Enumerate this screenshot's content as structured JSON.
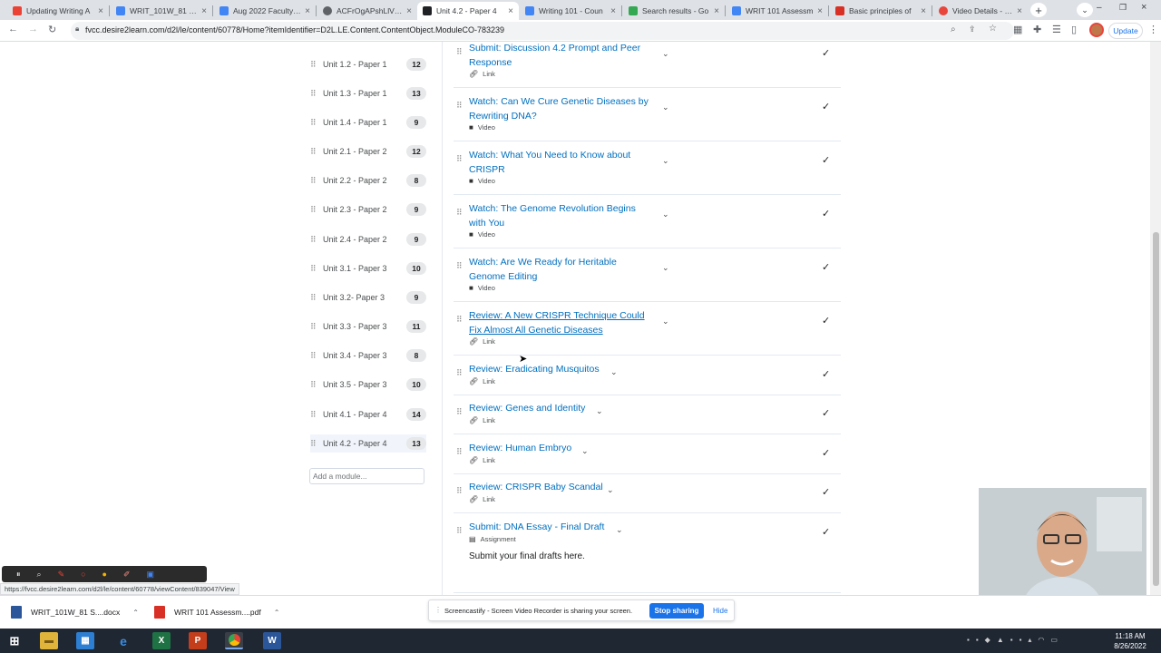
{
  "browser": {
    "tabs": [
      {
        "title": "Updating Writing A",
        "color": "#ea4335"
      },
      {
        "title": "WRIT_101W_81 SP..",
        "color": "#4285f4"
      },
      {
        "title": "Aug 2022 Faculty In",
        "color": "#4285f4"
      },
      {
        "title": "ACFrOgAPshLlVhg",
        "color": "#5f6368"
      },
      {
        "title": "Unit 4.2 - Paper 4",
        "color": "#202124"
      },
      {
        "title": "Writing 101 - Coun",
        "color": "#4285f4"
      },
      {
        "title": "Search results - Go",
        "color": "#34a853"
      },
      {
        "title": "WRIT 101 Assessm",
        "color": "#4285f4"
      },
      {
        "title": "Basic principles of",
        "color": "#d93025"
      },
      {
        "title": "Video Details - Scre",
        "color": "#e8453c"
      }
    ],
    "url": "fvcc.desire2learn.com/d2l/le/content/60778/Home?itemIdentifier=D2L.LE.Content.ContentObject.ModuleCO-783239",
    "update_label": "Update",
    "status_url": "https://fvcc.desire2learn.com/d2l/le/content/60778/viewContent/839047/View"
  },
  "modules": [
    {
      "label": "Unit 1.2 - Paper 1",
      "count": "12"
    },
    {
      "label": "Unit 1.3 - Paper 1",
      "count": "13"
    },
    {
      "label": "Unit 1.4 - Paper 1",
      "count": "9"
    },
    {
      "label": "Unit 2.1 - Paper 2",
      "count": "12"
    },
    {
      "label": "Unit 2.2 - Paper 2",
      "count": "8"
    },
    {
      "label": "Unit 2.3 - Paper 2",
      "count": "9"
    },
    {
      "label": "Unit 2.4 - Paper 2",
      "count": "9"
    },
    {
      "label": "Unit 3.1 - Paper 3",
      "count": "10"
    },
    {
      "label": "Unit 3.2- Paper 3",
      "count": "9"
    },
    {
      "label": "Unit 3.3 - Paper 3",
      "count": "11"
    },
    {
      "label": "Unit 3.4 - Paper 3",
      "count": "8"
    },
    {
      "label": "Unit 3.5 - Paper 3",
      "count": "10"
    },
    {
      "label": "Unit 4.1 - Paper 4",
      "count": "14"
    },
    {
      "label": "Unit 4.2 - Paper 4",
      "count": "13"
    }
  ],
  "add_module_placeholder": "Add a module...",
  "topics": [
    {
      "title": "Submit: Discussion 4.2 Prompt and Peer Response",
      "type": "Link"
    },
    {
      "title": "Watch: Can We Cure Genetic Diseases by Rewriting DNA?",
      "type": "Video"
    },
    {
      "title": "Watch: What You Need to Know about CRISPR",
      "type": "Video"
    },
    {
      "title": "Watch: The Genome Revolution Begins with You",
      "type": "Video"
    },
    {
      "title": "Watch: Are We Ready for Heritable Genome Editing",
      "type": "Video"
    },
    {
      "title": "Review: A New CRISPR Technique Could Fix Almost All Genetic Diseases",
      "type": "Link"
    },
    {
      "title": "Review: Eradicating Musquitos",
      "type": "Link"
    },
    {
      "title": "Review: Genes and Identity",
      "type": "Link"
    },
    {
      "title": "Review: Human Embryo",
      "type": "Link"
    },
    {
      "title": "Review: CRISPR Baby Scandal",
      "type": "Link"
    },
    {
      "title": "Submit: DNA Essay - Final Draft",
      "type": "Assignment",
      "description": "Submit your final drafts here."
    }
  ],
  "downloads": [
    {
      "name": "WRIT_101W_81 S....docx",
      "color": "#2b579a"
    },
    {
      "name": "WRIT 101 Assessm....pdf",
      "color": "#d93025"
    }
  ],
  "screen_share": {
    "message": "Screencastify - Screen Video Recorder is sharing your screen.",
    "stop_label": "Stop sharing",
    "hide_label": "Hide"
  },
  "taskbar": {
    "time": "11:18 AM",
    "date": "8/26/2022"
  }
}
